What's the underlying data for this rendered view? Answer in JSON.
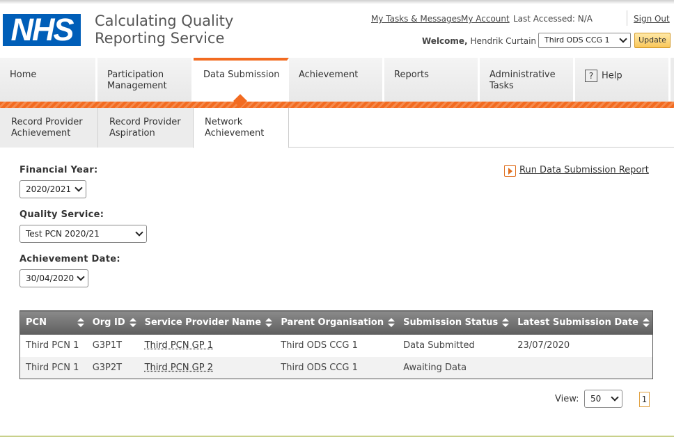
{
  "header": {
    "logo_text": "NHS",
    "app_title_line1": "Calculating Quality",
    "app_title_line2": "Reporting Service",
    "links": {
      "tasks": "My Tasks & Messages",
      "account": "My Account",
      "last_accessed": "Last Accessed: N/A",
      "sign_out": "Sign Out"
    },
    "welcome_prefix": "Welcome,",
    "user_name": "Hendrik Curtain",
    "org_selected": "Third ODS CCG 1",
    "update_label": "Update"
  },
  "main_nav": [
    {
      "label": "Home"
    },
    {
      "label": "Participation Management"
    },
    {
      "label": "Data Submission",
      "active": true
    },
    {
      "label": "Achievement"
    },
    {
      "label": "Reports"
    },
    {
      "label": "Administrative Tasks"
    },
    {
      "label": "Help",
      "icon": "question-icon"
    }
  ],
  "sub_nav": [
    {
      "label": "Record Provider Achievement"
    },
    {
      "label": "Record Provider Aspiration"
    },
    {
      "label": "Network Achievement",
      "active": true
    }
  ],
  "form": {
    "financial_year_label": "Financial Year:",
    "financial_year_value": "2020/2021",
    "quality_service_label": "Quality Service:",
    "quality_service_value": "Test PCN 2020/21",
    "achievement_date_label": "Achievement Date:",
    "achievement_date_value": "30/04/2020",
    "run_report_label": "Run Data Submission Report"
  },
  "table": {
    "columns": [
      "PCN",
      "Org ID",
      "Service Provider Name",
      "Parent Organisation",
      "Submission Status",
      "Latest Submission Date"
    ],
    "rows": [
      [
        "Third PCN 1",
        "G3P1T",
        "Third PCN GP 1",
        "Third ODS CCG 1",
        "Data Submitted",
        "23/07/2020"
      ],
      [
        "Third PCN 1",
        "G3P2T",
        "Third PCN GP 2",
        "Third ODS CCG 1",
        "Awaiting Data",
        ""
      ]
    ]
  },
  "pager": {
    "view_label": "View:",
    "page_size": "50",
    "current_page": "1"
  },
  "colors": {
    "nhs_blue": "#005eb8",
    "accent_orange": "#f26b21"
  }
}
